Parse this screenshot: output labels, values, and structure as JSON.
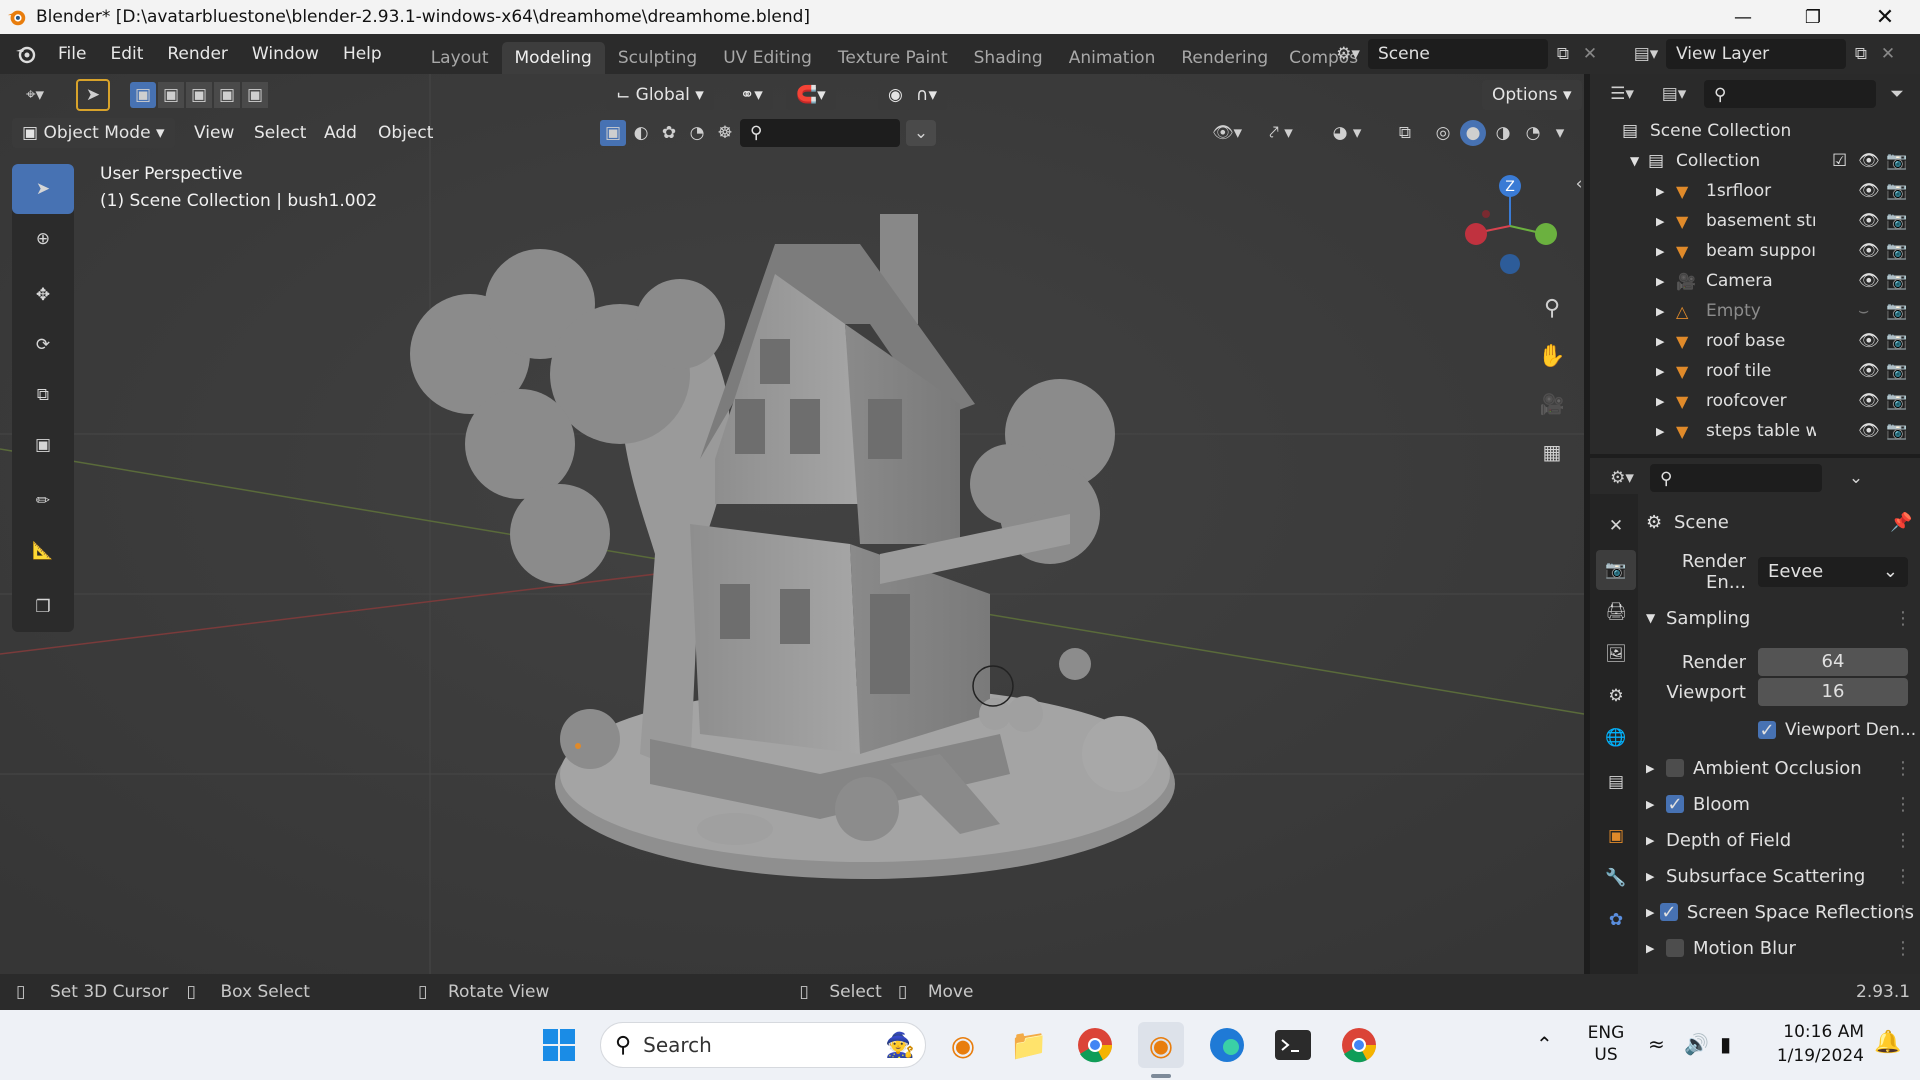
{
  "window": {
    "title": "Blender* [D:\\avatarbluestone\\blender-2.93.1-windows-x64\\dreamhome\\dreamhome.blend]"
  },
  "menu": [
    "File",
    "Edit",
    "Render",
    "Window",
    "Help"
  ],
  "workspaces": [
    "Layout",
    "Modeling",
    "Sculpting",
    "UV Editing",
    "Texture Paint",
    "Shading",
    "Animation",
    "Rendering",
    "Compos"
  ],
  "active_workspace": "Modeling",
  "scene_field": "Scene",
  "view_layer_field": "View Layer",
  "toolheader": {
    "orientation": "Global",
    "options": "Options"
  },
  "viewport_header": {
    "mode": "Object Mode",
    "menus": [
      "View",
      "Select",
      "Add",
      "Object"
    ]
  },
  "viewport": {
    "perspective": "User Perspective",
    "context": "(1) Scene Collection | bush1.002"
  },
  "gizmo": {
    "z_label": "Z"
  },
  "outliner": {
    "root": "Scene Collection",
    "collection": "Collection",
    "items": [
      "1srfloor",
      "basement stı",
      "beam suppoı",
      "Camera",
      "Empty",
      "roof base",
      "roof tile",
      "roofcover",
      "steps table w"
    ]
  },
  "properties": {
    "title": "Scene",
    "render_engine_label": "Render En...",
    "render_engine": "Eevee",
    "sampling": "Sampling",
    "render_label": "Render",
    "render_value": "64",
    "viewport_label": "Viewport",
    "viewport_value": "16",
    "viewport_denoise": "Viewport Den...",
    "panels": [
      {
        "label": "Ambient Occlusion",
        "checkbox": true,
        "checked": false
      },
      {
        "label": "Bloom",
        "checkbox": true,
        "checked": true
      },
      {
        "label": "Depth of Field",
        "checkbox": false,
        "checked": false
      },
      {
        "label": "Subsurface Scattering",
        "checkbox": false,
        "checked": false
      },
      {
        "label": "Screen Space Reflections",
        "checkbox": true,
        "checked": true
      },
      {
        "label": "Motion Blur",
        "checkbox": true,
        "checked": false
      }
    ]
  },
  "statusbar": {
    "set_cursor": "Set 3D Cursor",
    "box_select": "Box Select",
    "rotate_view": "Rotate View",
    "select": "Select",
    "move": "Move",
    "version": "2.93.1"
  },
  "taskbar": {
    "search": "Search",
    "lang_top": "ENG",
    "lang_bottom": "US",
    "time": "10:16 AM",
    "date": "1/19/2024"
  },
  "colors": {
    "accent": "#4772b3",
    "axis_x": "#d9434f",
    "axis_y": "#6bb13f",
    "axis_z": "#3a7bd5",
    "mesh": "#9a9a9a",
    "orange": "#e08a2a"
  }
}
